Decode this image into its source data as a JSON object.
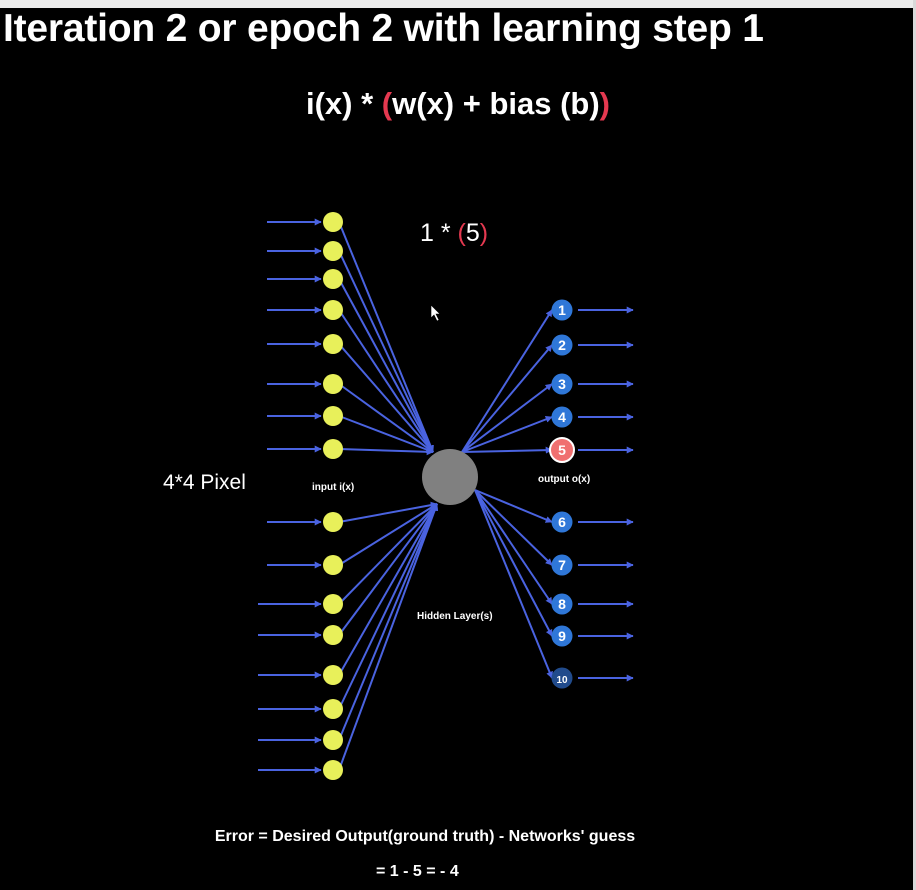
{
  "title": "Iteration 2 or epoch  2 with learning step 1",
  "formula": {
    "part_a": "i(x) * ",
    "open_paren": "(",
    "part_b": "w(x) + bias (b)",
    "close_paren": ")"
  },
  "calculation": {
    "prefix": "1 * ",
    "open_paren": "(",
    "value": "5",
    "close_paren": ")"
  },
  "labels": {
    "pixel": "4*4 Pixel",
    "input": "input i(x)",
    "output": "output o(x)",
    "hidden": "Hidden Layer(s)"
  },
  "output_nodes": [
    "1",
    "2",
    "3",
    "4",
    "5",
    "6",
    "7",
    "8",
    "9",
    "10"
  ],
  "highlighted_output": "5",
  "input_node_count": 16,
  "error": {
    "equation": "Error =  Desired Output(ground truth) - Networks' guess",
    "result": "= 1 - 5 = - 4"
  },
  "colors": {
    "background": "#000000",
    "accent": "#e53950",
    "input_node": "#e8f05a",
    "hidden_node": "#808080",
    "output_node": "#2f77d8",
    "output_node_dark": "#214b8c",
    "highlight_node": "#f07070",
    "edge": "#4a63e0"
  }
}
